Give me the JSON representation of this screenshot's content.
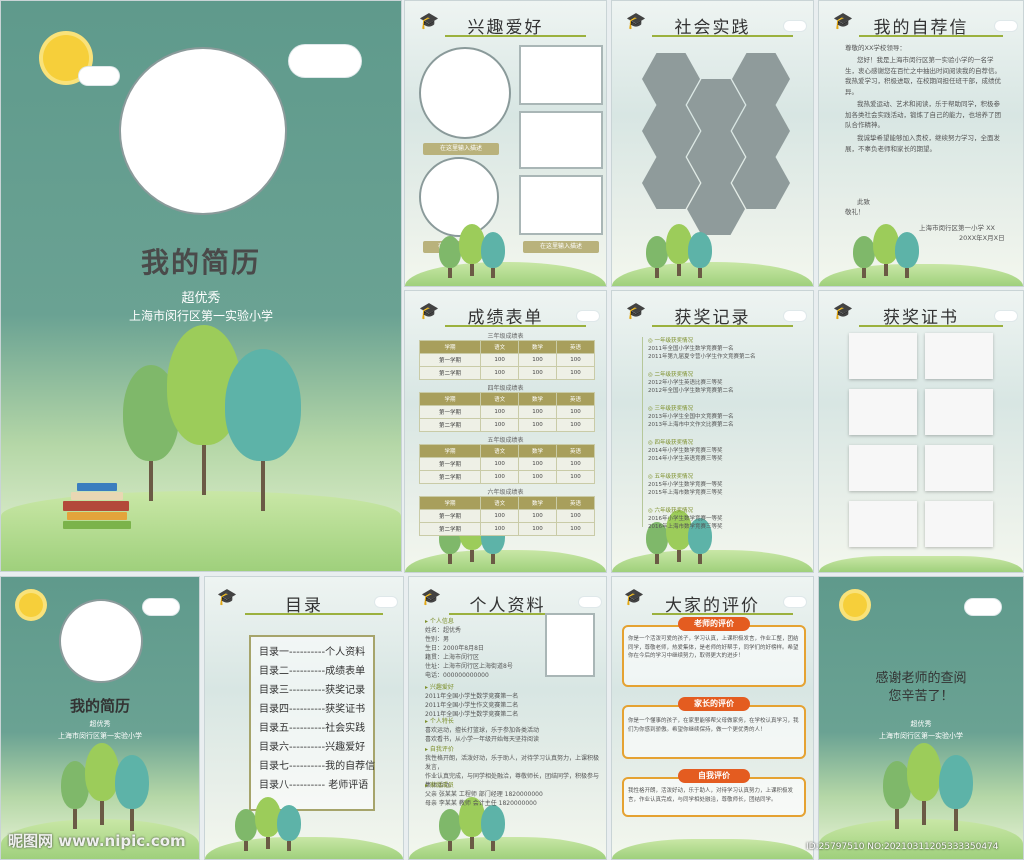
{
  "cover": {
    "title": "我的简历",
    "subtitle": "超优秀",
    "school": "上海市闵行区第一实验小学"
  },
  "hobbies": {
    "title": "兴趣爱好",
    "labels": [
      "在这里输入描述",
      "在这里输入描述",
      "在这里输入描述"
    ]
  },
  "practice": {
    "title": "社会实践"
  },
  "letter": {
    "title": "我的自荐信",
    "greeting": "尊敬的XX学校领导：",
    "body": [
      "您好！我是上海市闵行区第一实验小学的一名学生，衷心感谢您在百忙之中抽出时间阅读我的自荐信。我热爱学习，积极进取，在校期间担任班干部，成绩优异。",
      "我热爱运动、艺术和阅读，乐于帮助同学，积极参加各类社会实践活动，锻炼了自己的能力，也培养了团队合作精神。",
      "我诚挚希望能够加入贵校，继续努力学习，全面发展，不辜负老师和家长的期望。",
      "此致",
      "敬礼！"
    ],
    "signature": "上海市闵行区第一小学 XX",
    "date": "20XX年X月X日"
  },
  "grades": {
    "title": "成绩表单",
    "tables": [
      {
        "name": "三年级成绩表",
        "headers": [
          "学期",
          "语文",
          "数学",
          "英语"
        ],
        "rows": [
          [
            "第一学期",
            "100",
            "100",
            "100"
          ],
          [
            "第二学期",
            "100",
            "100",
            "100"
          ]
        ]
      },
      {
        "name": "四年级成绩表",
        "headers": [
          "学期",
          "语文",
          "数学",
          "英语"
        ],
        "rows": [
          [
            "第一学期",
            "100",
            "100",
            "100"
          ],
          [
            "第二学期",
            "100",
            "100",
            "100"
          ]
        ]
      },
      {
        "name": "五年级成绩表",
        "headers": [
          "学期",
          "语文",
          "数学",
          "英语"
        ],
        "rows": [
          [
            "第一学期",
            "100",
            "100",
            "100"
          ],
          [
            "第二学期",
            "100",
            "100",
            "100"
          ]
        ]
      },
      {
        "name": "六年级成绩表",
        "headers": [
          "学期",
          "语文",
          "数学",
          "英语"
        ],
        "rows": [
          [
            "第一学期",
            "100",
            "100",
            "100"
          ],
          [
            "第二学期",
            "100",
            "100",
            "100"
          ]
        ]
      }
    ]
  },
  "awards": {
    "title": "获奖记录",
    "items": [
      {
        "head": "一年级获奖情况",
        "lines": [
          "2011年全国小学生数学竞赛第一名",
          "2011年第九届夏令营小学生作文竞赛第二名"
        ]
      },
      {
        "head": "二年级获奖情况",
        "lines": [
          "2012年小学生英语比赛三等奖",
          "2012年全国小学生数学竞赛第二名"
        ]
      },
      {
        "head": "三年级获奖情况",
        "lines": [
          "2013年小学生全国中文竞赛第一名",
          "2013年上海市中文作文比赛第二名"
        ]
      },
      {
        "head": "四年级获奖情况",
        "lines": [
          "2014年小学生数学竞赛三等奖",
          "2014年小学生英语竞赛三等奖"
        ]
      },
      {
        "head": "五年级获奖情况",
        "lines": [
          "2015年小学生数学竞赛一等奖",
          "2015年上海市数学竞赛三等奖"
        ]
      },
      {
        "head": "六年级获奖情况",
        "lines": [
          "2016年小学生数学竞赛一等奖",
          "2016年上海市数学竞赛三等奖"
        ]
      }
    ]
  },
  "certs": {
    "title": "获奖证书"
  },
  "cover2": {
    "title": "我的简历",
    "subtitle": "超优秀",
    "school": "上海市闵行区第一实验小学"
  },
  "toc": {
    "title": "目录",
    "items": [
      "目录一----------个人资料",
      "目录二----------成绩表单",
      "目录三----------获奖记录",
      "目录四----------获奖证书",
      "目录五----------社会实践",
      "目录六----------兴趣爱好",
      "目录七----------我的自荐信",
      "目录八---------- 老师评语"
    ]
  },
  "profile": {
    "title": "个人资料",
    "sections": [
      {
        "head": "个人信息",
        "lines": [
          "姓名：超优秀",
          "性别：男",
          "生日：2000年8月8日",
          "籍贯：上海市闵行区",
          "住址：上海市闵行区上海街道8号",
          "电话：000000000000"
        ]
      },
      {
        "head": "兴趣爱好",
        "lines": [
          "2011年全国小学生数学竞赛第一名",
          "2011年全国小学生作文竞赛第二名",
          "2011年全国小学生数学竞赛第二名"
        ]
      },
      {
        "head": "个人特长",
        "lines": [
          "喜欢运动，擅长打篮球，乐于参加各类活动",
          "喜欢看书，从小学一年级开始每天坚持阅读"
        ]
      },
      {
        "head": "自我评价",
        "lines": [
          "我性格开朗，活泼好动，乐于助人，对待学习认真努力，上课积极发言，",
          "作业认真完成，与同学相处融洽，尊敬师长，团结同学，积极参与集体活动。"
        ]
      },
      {
        "head": "家庭成员",
        "lines": [
          "父亲  张某某   工程师   部门经理   1820000000",
          "母亲  李某某   教师     会计主任   1820000000"
        ]
      }
    ]
  },
  "evaluation": {
    "title": "大家的评价",
    "teacher_tag": "老师的评价",
    "teacher_text": "你是一个活泼可爱的孩子，学习认真，上课积极发言，作业工整，团结同学，尊敬老师，热爱集体，是老师的好帮手，同学们的好榜样。希望你在今后的学习中继续努力，取得更大的进步！",
    "parent_tag": "家长的评价",
    "parent_text": "你是一个懂事的孩子，在家里能够帮父母做家务，在学校认真学习，我们为你感到骄傲。希望你继续保持，做一个更优秀的人！",
    "self_tag": "自我评价",
    "self_text": "我性格开朗，活泼好动，乐于助人，对待学习认真努力，上课积极发言，作业认真完成，与同学相处融洽，尊敬师长，团结同学。"
  },
  "thanks": {
    "line1": "感谢老师的查阅",
    "line2": "您辛苦了！",
    "name": "超优秀",
    "school": "上海市闵行区第一实验小学"
  },
  "watermark": {
    "logo": "昵图网 www.nipic.com",
    "id": "ID:25797510 NO:20210311205333350474"
  }
}
